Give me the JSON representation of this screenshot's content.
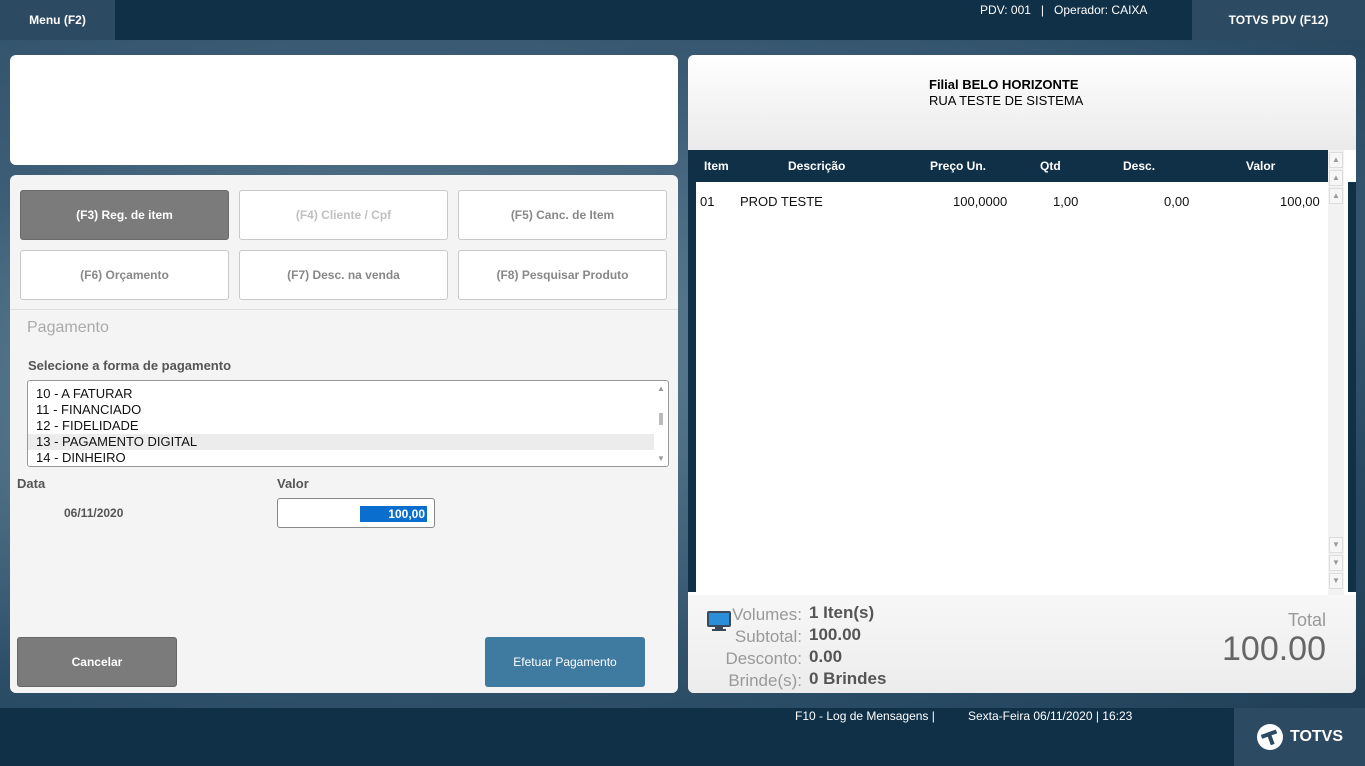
{
  "topbar": {
    "menu_label": "Menu (F2)",
    "pdv": "PDV: 001",
    "separator": "|",
    "operador": "Operador: CAIXA",
    "totvs_label": "TOTVS PDV (F12)"
  },
  "function_buttons": [
    {
      "label": "(F3) Reg. de item"
    },
    {
      "label": "(F4) Cliente / Cpf"
    },
    {
      "label": "(F5) Canc. de Item"
    },
    {
      "label": "(F6) Orçamento"
    },
    {
      "label": "(F7) Desc. na venda"
    },
    {
      "label": "(F8) Pesquisar Produto"
    }
  ],
  "payment": {
    "title": "Pagamento",
    "select_label": "Selecione a forma de pagamento",
    "options": [
      "10 - A FATURAR",
      "11 - FINANCIADO",
      "12 - FIDELIDADE",
      "13 - PAGAMENTO DIGITAL",
      "14 - DINHEIRO"
    ],
    "data_label": "Data",
    "valor_label": "Valor",
    "date_value": "06/11/2020",
    "valor_value": "100,00",
    "cancel_label": "Cancelar",
    "pay_label": "Efetuar Pagamento"
  },
  "receipt": {
    "filial": "Filial BELO HORIZONTE",
    "address": "RUA TESTE DE SISTEMA",
    "columns": [
      "Item",
      "Descrição",
      "Preço Un.",
      "Qtd",
      "Desc.",
      "Valor"
    ],
    "rows": [
      {
        "item": "01",
        "descricao": "PROD TESTE",
        "preco": "100,0000",
        "qtd": "1,00",
        "desc": "0,00",
        "valor": "100,00"
      }
    ]
  },
  "totals": {
    "volumes_label": "Volumes:",
    "volumes_value": "1 Iten(s)",
    "subtotal_label": "Subtotal:",
    "subtotal_value": "100.00",
    "desconto_label": "Desconto:",
    "desconto_value": "0.00",
    "brindes_label": "Brinde(s):",
    "brindes_value": "0 Brindes",
    "total_label": "Total",
    "total_value": "100.00"
  },
  "statusbar": {
    "log": "F10 - Log de Mensagens |",
    "datetime": "Sexta-Feira 06/11/2020 | 16:23",
    "logo_text": "TOTVS"
  }
}
